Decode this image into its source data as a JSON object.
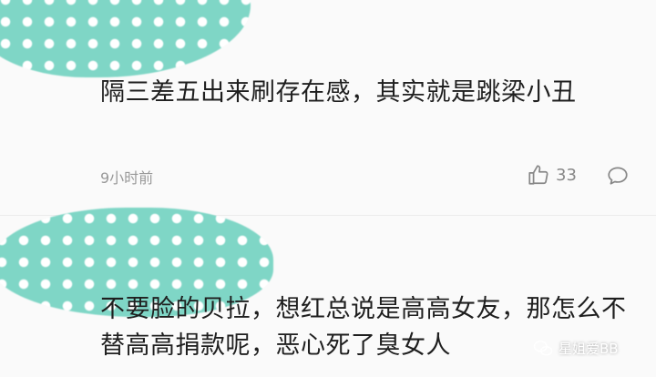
{
  "comments": [
    {
      "text": "隔三差五出来刷存在感，其实就是跳梁小丑",
      "time": "9小时前",
      "likes": "33"
    },
    {
      "text": "不要脸的贝拉，想红总说是高高女友，那怎么不替高高捐款呢，恶心死了臭女人"
    }
  ],
  "watermark": {
    "text": "星姐爱BB"
  },
  "icons": {
    "like": "thumbs-up-icon",
    "reply": "speech-bubble-icon",
    "watermark": "wechat-icon"
  }
}
